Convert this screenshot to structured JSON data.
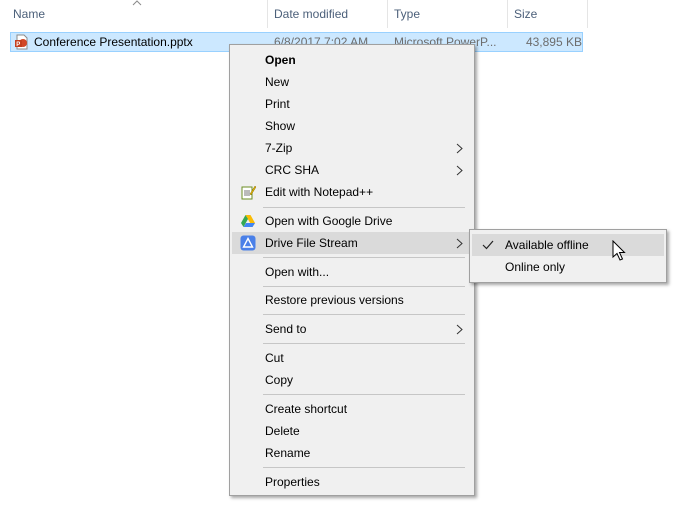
{
  "columns": {
    "name": "Name",
    "date_modified": "Date modified",
    "type": "Type",
    "size": "Size"
  },
  "file": {
    "name": "Conference Presentation.pptx",
    "date_modified": "6/8/2017 7:02 AM",
    "type": "Microsoft PowerP...",
    "size": "43,895 KB",
    "icon": "pptx-file-icon"
  },
  "context_menu": {
    "items": {
      "open": "Open",
      "new": "New",
      "print": "Print",
      "show": "Show",
      "seven_zip": "7-Zip",
      "crc_sha": "CRC SHA",
      "edit_notepadpp": "Edit with Notepad++",
      "open_google_drive": "Open with Google Drive",
      "drive_file_stream": "Drive File Stream",
      "open_with": "Open with...",
      "restore_previous": "Restore previous versions",
      "send_to": "Send to",
      "cut": "Cut",
      "copy": "Copy",
      "create_shortcut": "Create shortcut",
      "delete": "Delete",
      "rename": "Rename",
      "properties": "Properties"
    }
  },
  "submenu": {
    "available_offline": "Available offline",
    "online_only": "Online only",
    "checked_item": "available_offline"
  },
  "colors": {
    "selection_fill": "#cce8ff",
    "selection_border": "#99d1ff",
    "menu_background": "#f0f0f0",
    "menu_highlight": "#dadada",
    "header_text": "#4c607a"
  }
}
